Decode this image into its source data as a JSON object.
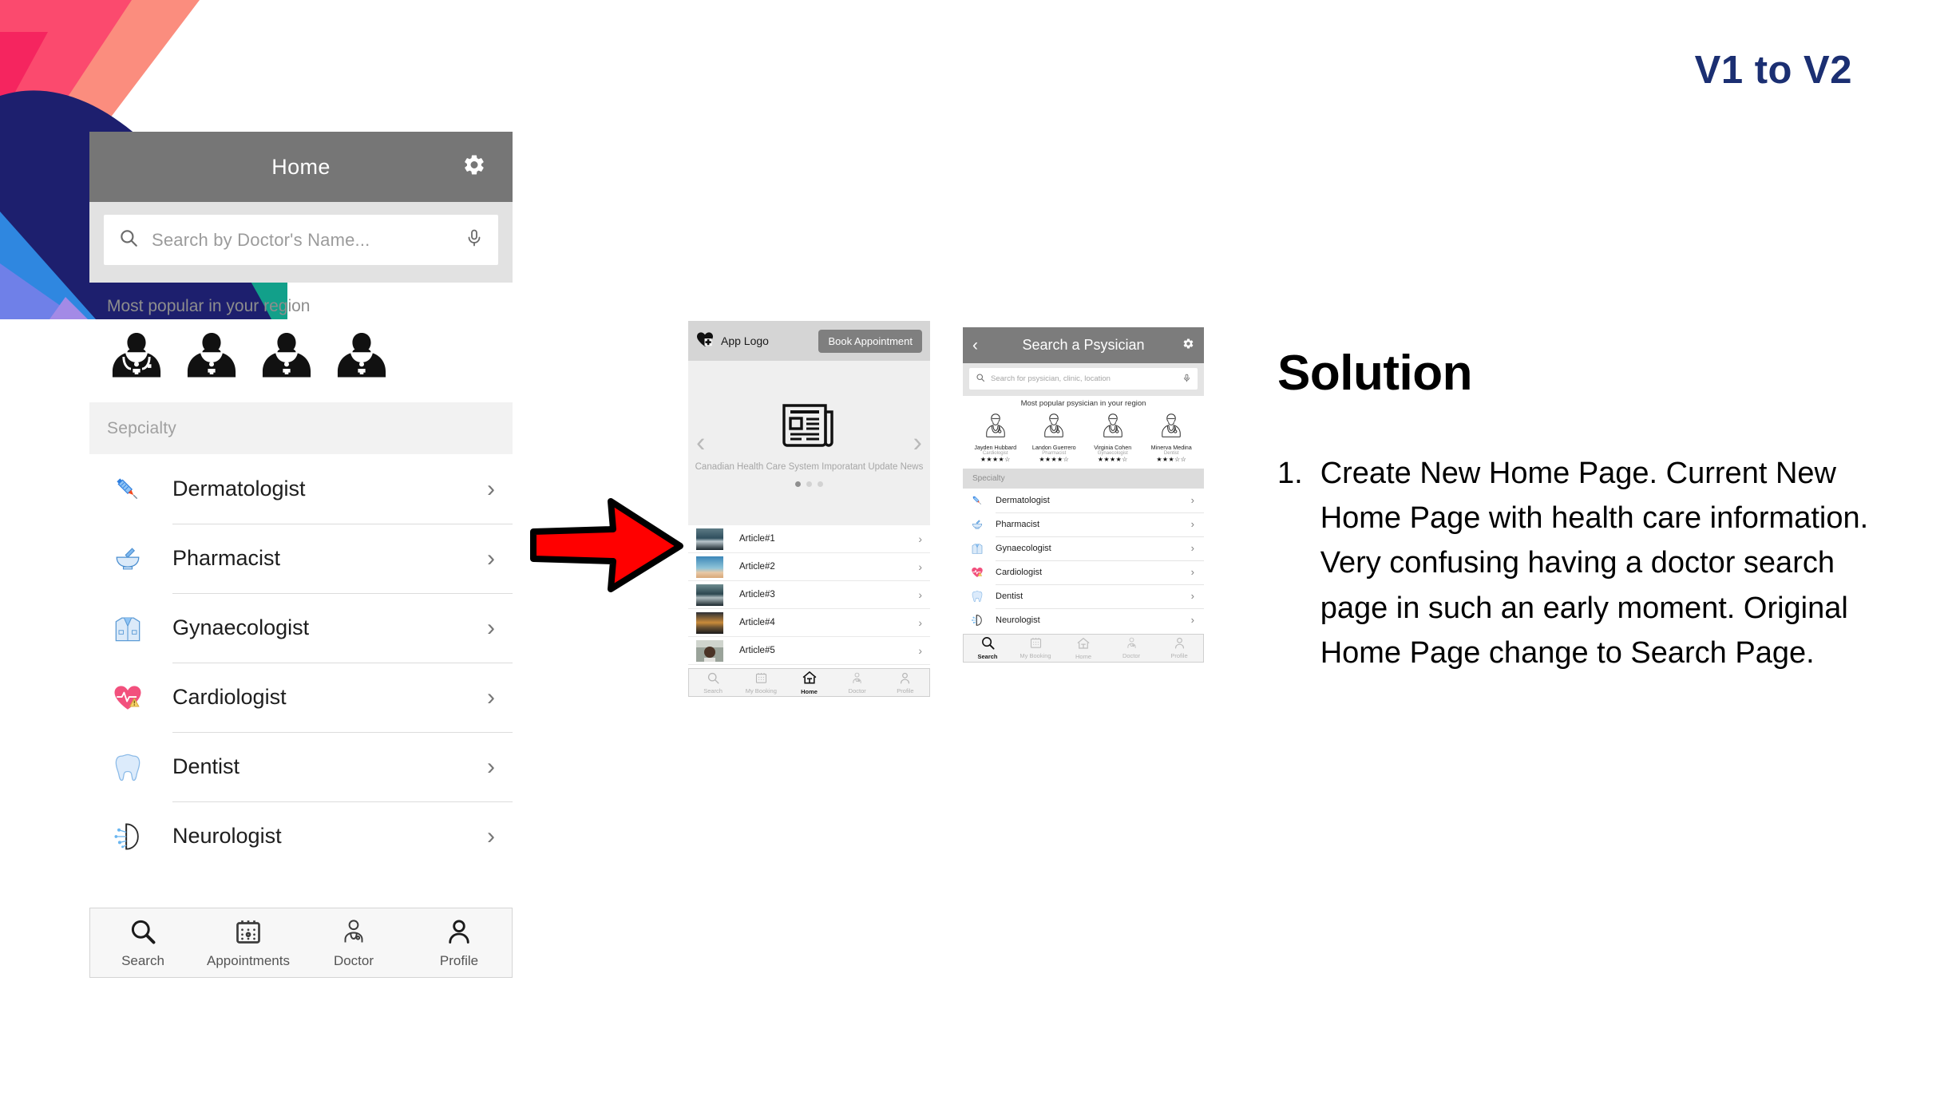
{
  "deck": {
    "title": "V1 to V2"
  },
  "phone1": {
    "header": {
      "title": "Home",
      "settings_icon": "gear-icon"
    },
    "search": {
      "placeholder": "Search by Doctor's Name...",
      "search_icon": "search-icon",
      "mic_icon": "microphone-icon"
    },
    "popular_label": "Most popular in your region",
    "popular_count": 4,
    "specialty_header": "Sepcialty",
    "specialties": [
      {
        "label": "Dermatologist",
        "icon": "syringe-icon"
      },
      {
        "label": "Pharmacist",
        "icon": "mortar-pestle-icon"
      },
      {
        "label": "Gynaecologist",
        "icon": "lab-coat-icon"
      },
      {
        "label": "Cardiologist",
        "icon": "heart-pulse-icon"
      },
      {
        "label": "Dentist",
        "icon": "tooth-icon"
      },
      {
        "label": "Neurologist",
        "icon": "brain-icon"
      }
    ],
    "nav": [
      {
        "label": "Search",
        "icon": "magnifier-icon",
        "active": true
      },
      {
        "label": "Appointments",
        "icon": "calendar-icon",
        "active": false
      },
      {
        "label": "Doctor",
        "icon": "doctor-icon",
        "active": false
      },
      {
        "label": "Profile",
        "icon": "person-icon",
        "active": false
      }
    ]
  },
  "phone2": {
    "header": {
      "logo_icon": "heart-plus-icon",
      "logo_text": "App Logo",
      "book_button": "Book Appointment"
    },
    "carousel": {
      "prev_icon": "chevron-left-icon",
      "next_icon": "chevron-right-icon",
      "slide_icon": "newspaper-icon",
      "caption": "Canadian Health Care System Imporatant Update News",
      "dots": 3,
      "active_dot": 0
    },
    "articles": [
      {
        "title": "Article#1"
      },
      {
        "title": "Article#2"
      },
      {
        "title": "Article#3"
      },
      {
        "title": "Article#4"
      },
      {
        "title": "Article#5"
      }
    ],
    "nav": [
      {
        "label": "Search",
        "icon": "magnifier-icon",
        "active": false
      },
      {
        "label": "My Booking",
        "icon": "calendar-icon",
        "active": false
      },
      {
        "label": "Home",
        "icon": "home-icon",
        "active": true
      },
      {
        "label": "Doctor",
        "icon": "doctor-icon",
        "active": false
      },
      {
        "label": "Profile",
        "icon": "person-icon",
        "active": false
      }
    ]
  },
  "phone3": {
    "header": {
      "back_icon": "chevron-left-icon",
      "title": "Search a Psysician",
      "settings_icon": "gear-icon"
    },
    "search": {
      "placeholder": "Search for psysician, clinic, location",
      "search_icon": "search-icon",
      "mic_icon": "microphone-icon"
    },
    "popular_label": "Most popular psysician in your region",
    "doctors": [
      {
        "name": "Jayden Hubbard",
        "specialty": "Cardiologist",
        "rating": 4,
        "stars": "★★★★☆"
      },
      {
        "name": "Landon Guerrero",
        "specialty": "Pharmacist",
        "rating": 4,
        "stars": "★★★★☆"
      },
      {
        "name": "Virginia Cohen",
        "specialty": "Gynaecologist",
        "rating": 4,
        "stars": "★★★★☆"
      },
      {
        "name": "Minerva Medina",
        "specialty": "Dentist",
        "rating": 3,
        "stars": "★★★☆☆"
      }
    ],
    "specialty_header": "Specialty",
    "specialties": [
      {
        "label": "Dermatologist",
        "icon": "syringe-icon"
      },
      {
        "label": "Pharmacist",
        "icon": "mortar-pestle-icon"
      },
      {
        "label": "Gynaecologist",
        "icon": "lab-coat-icon"
      },
      {
        "label": "Cardiologist",
        "icon": "heart-pulse-icon"
      },
      {
        "label": "Dentist",
        "icon": "tooth-icon"
      },
      {
        "label": "Neurologist",
        "icon": "brain-icon"
      }
    ],
    "nav": [
      {
        "label": "Search",
        "icon": "magnifier-icon",
        "active": true
      },
      {
        "label": "My Booking",
        "icon": "calendar-icon",
        "active": false
      },
      {
        "label": "Home",
        "icon": "home-icon",
        "active": false
      },
      {
        "label": "Doctor",
        "icon": "doctor-icon",
        "active": false
      },
      {
        "label": "Profile",
        "icon": "person-icon",
        "active": false
      }
    ]
  },
  "arrow": {
    "icon": "right-arrow-icon",
    "color": "#ff0000"
  },
  "solution": {
    "heading": "Solution",
    "items": [
      {
        "number": "1.",
        "text": "Create New Home Page. Current New Home Page with health care information. Very confusing having a doctor search page in such an early moment. Original Home Page change to Search Page."
      }
    ]
  },
  "colors": {
    "title_blue": "#1b2f72",
    "phone_header_gray": "#767676",
    "arrow_red": "#ff0000",
    "deco_pink": "#fb4a6e",
    "deco_salmon": "#fb8d7e",
    "deco_navy": "#1d1f6e",
    "deco_teal": "#12a08a",
    "deco_blue": "#2f87e0",
    "deco_periwinkle": "#6f80e8"
  }
}
